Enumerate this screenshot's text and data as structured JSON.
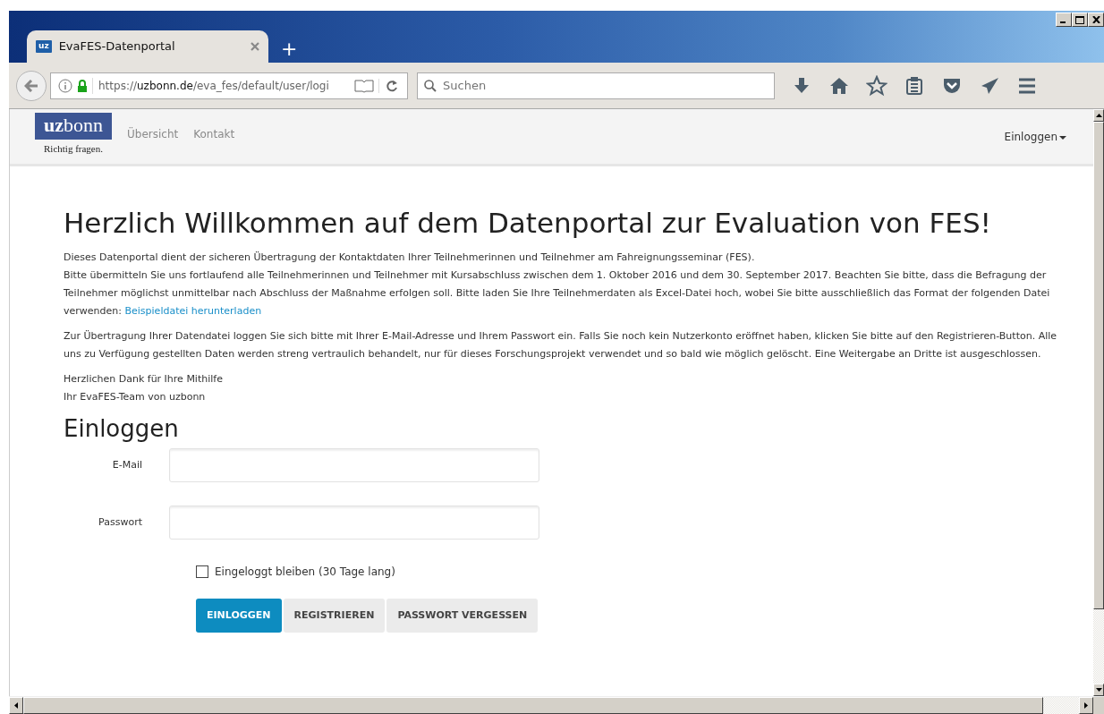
{
  "browser": {
    "tab": {
      "title": "EvaFES-Datenportal",
      "favicon": "uz",
      "selected": true
    },
    "new_tab": "+",
    "url": {
      "prefix": "https://",
      "domain": "uzbonn.de",
      "path": "/eva_fes/default/user/logi"
    },
    "search": {
      "placeholder": "Suchen"
    }
  },
  "navbar": {
    "logo": {
      "brand_bold": "uz",
      "brand_light": "bonn",
      "tagline": "Richtig fragen."
    },
    "links": [
      "Übersicht",
      "Kontakt"
    ],
    "account": "Einloggen"
  },
  "heading": "Herzlich Willkommen auf dem Datenportal zur Evaluation von FES!",
  "intro": {
    "lines": [
      "Dieses Datenportal dient der sicheren Übertragung der Kontaktdaten Ihrer Teilnehmerinnen und Teilnehmer am Fahreignungsseminar (FES).",
      "Bitte übermitteln Sie uns fortlaufend alle Teilnehmerinnen und Teilnehmer mit Kursabschluss zwischen dem 1. Oktober 2016 und dem 30. September 2017. Beachten Sie bitte, dass die Befragung der Teilnehmer möglichst unmittelbar nach Abschluss der Maßnahme erfolgen soll. Bitte laden Sie Ihre Teilnehmerdaten als Excel-Datei hoch, wobei Sie bitte ausschließlich das Format der folgenden Datei verwenden: "
    ],
    "link": "Beispieldatei herunterladen"
  },
  "privacy": "Zur Übertragung Ihrer Datendatei loggen Sie sich bitte mit Ihrer E-Mail-Adresse und Ihrem Passwort ein. Falls Sie noch kein Nutzerkonto eröffnet haben, klicken Sie bitte auf den Registrieren-Button. Alle uns zu Verfügung gestellten Daten werden streng vertraulich behandelt, nur für dieses Forschungsprojekt verwendet und so bald wie möglich gelöscht. Eine Weitergabe an Dritte ist ausgeschlossen.",
  "closing": [
    "Herzlichen Dank für Ihre Mithilfe",
    "Ihr EvaFES-Team von uzbonn"
  ],
  "login": {
    "title": "Einloggen",
    "fields": [
      {
        "label": "E-Mail"
      },
      {
        "label": "Passwort"
      }
    ],
    "remember": {
      "label": "Eingeloggt bleiben (30 Tage lang)",
      "checked": false
    },
    "buttons": [
      {
        "label": "EINLOGGEN",
        "kind": "primary"
      },
      {
        "label": "REGISTRIEREN",
        "kind": "secondary"
      },
      {
        "label": "PASSWORT VERGESSEN",
        "kind": "secondary"
      }
    ]
  }
}
